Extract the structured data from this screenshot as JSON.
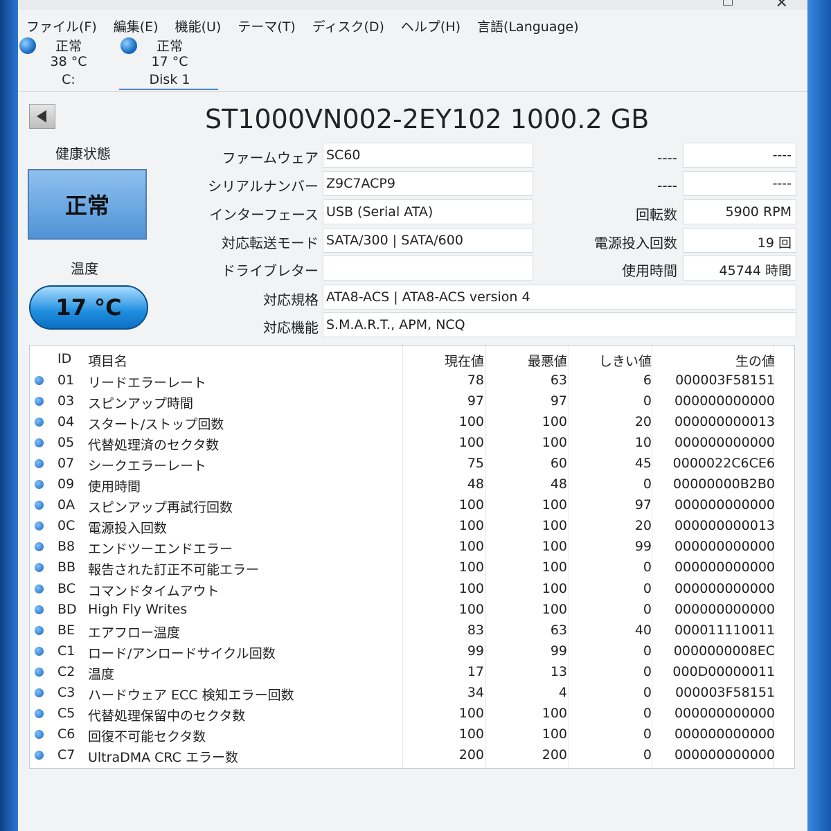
{
  "menu": [
    "ファイル(F)",
    "編集(E)",
    "機能(U)",
    "テーマ(T)",
    "ディスク(D)",
    "ヘルプ(H)",
    "言語(Language)"
  ],
  "disk_tabs": [
    {
      "status": "正常",
      "temp": "38 °C",
      "name": "C:"
    },
    {
      "status": "正常",
      "temp": "17 °C",
      "name": "Disk 1"
    }
  ],
  "disk_title": "ST1000VN002-2EY102 1000.2 GB",
  "health": {
    "label": "健康状態",
    "value": "正常"
  },
  "temperature": {
    "label": "温度",
    "value": "17 °C"
  },
  "fields": {
    "firmware": {
      "label": "ファームウェア",
      "value": "SC60"
    },
    "serial": {
      "label": "シリアルナンバー",
      "value": "Z9C7ACP9"
    },
    "interface": {
      "label": "インターフェース",
      "value": "USB (Serial ATA)"
    },
    "transfer": {
      "label": "対応転送モード",
      "value": "SATA/300 | SATA/600"
    },
    "drive_letter": {
      "label": "ドライブレター",
      "value": ""
    },
    "standard": {
      "label": "対応規格",
      "value": "ATA8-ACS | ATA8-ACS version 4"
    },
    "features": {
      "label": "対応機能",
      "value": "S.M.A.R.T., APM, NCQ"
    }
  },
  "right_fields": {
    "r1": {
      "label": "----",
      "value": "----"
    },
    "r2": {
      "label": "----",
      "value": "----"
    },
    "rpm": {
      "label": "回転数",
      "value": "5900 RPM"
    },
    "power_count": {
      "label": "電源投入回数",
      "value": "19 回"
    },
    "hours": {
      "label": "使用時間",
      "value": "45744 時間"
    }
  },
  "smart_headers": {
    "id": "ID",
    "name": "項目名",
    "current": "現在値",
    "worst": "最悪値",
    "threshold": "しきい値",
    "raw": "生の値"
  },
  "smart_rows": [
    {
      "id": "01",
      "name": "リードエラーレート",
      "current": "78",
      "worst": "63",
      "threshold": "6",
      "raw": "000003F58151"
    },
    {
      "id": "03",
      "name": "スピンアップ時間",
      "current": "97",
      "worst": "97",
      "threshold": "0",
      "raw": "000000000000"
    },
    {
      "id": "04",
      "name": "スタート/ストップ回数",
      "current": "100",
      "worst": "100",
      "threshold": "20",
      "raw": "000000000013"
    },
    {
      "id": "05",
      "name": "代替処理済のセクタ数",
      "current": "100",
      "worst": "100",
      "threshold": "10",
      "raw": "000000000000"
    },
    {
      "id": "07",
      "name": "シークエラーレート",
      "current": "75",
      "worst": "60",
      "threshold": "45",
      "raw": "0000022C6CE6"
    },
    {
      "id": "09",
      "name": "使用時間",
      "current": "48",
      "worst": "48",
      "threshold": "0",
      "raw": "00000000B2B0"
    },
    {
      "id": "0A",
      "name": "スピンアップ再試行回数",
      "current": "100",
      "worst": "100",
      "threshold": "97",
      "raw": "000000000000"
    },
    {
      "id": "0C",
      "name": "電源投入回数",
      "current": "100",
      "worst": "100",
      "threshold": "20",
      "raw": "000000000013"
    },
    {
      "id": "B8",
      "name": "エンドツーエンドエラー",
      "current": "100",
      "worst": "100",
      "threshold": "99",
      "raw": "000000000000"
    },
    {
      "id": "BB",
      "name": "報告された訂正不可能エラー",
      "current": "100",
      "worst": "100",
      "threshold": "0",
      "raw": "000000000000"
    },
    {
      "id": "BC",
      "name": "コマンドタイムアウト",
      "current": "100",
      "worst": "100",
      "threshold": "0",
      "raw": "000000000000"
    },
    {
      "id": "BD",
      "name": "High Fly Writes",
      "current": "100",
      "worst": "100",
      "threshold": "0",
      "raw": "000000000000"
    },
    {
      "id": "BE",
      "name": "エアフロー温度",
      "current": "83",
      "worst": "63",
      "threshold": "40",
      "raw": "000011110011"
    },
    {
      "id": "C1",
      "name": "ロード/アンロードサイクル回数",
      "current": "99",
      "worst": "99",
      "threshold": "0",
      "raw": "0000000008EC"
    },
    {
      "id": "C2",
      "name": "温度",
      "current": "17",
      "worst": "13",
      "threshold": "0",
      "raw": "000D00000011"
    },
    {
      "id": "C3",
      "name": "ハードウェア ECC 検知エラー回数",
      "current": "34",
      "worst": "4",
      "threshold": "0",
      "raw": "000003F58151"
    },
    {
      "id": "C5",
      "name": "代替処理保留中のセクタ数",
      "current": "100",
      "worst": "100",
      "threshold": "0",
      "raw": "000000000000"
    },
    {
      "id": "C6",
      "name": "回復不可能セクタ数",
      "current": "100",
      "worst": "100",
      "threshold": "0",
      "raw": "000000000000"
    },
    {
      "id": "C7",
      "name": "UltraDMA CRC エラー数",
      "current": "200",
      "worst": "200",
      "threshold": "0",
      "raw": "000000000000"
    }
  ]
}
